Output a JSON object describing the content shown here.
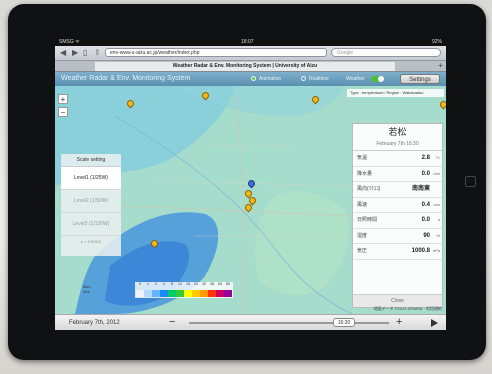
{
  "status": {
    "carrier": "SMSG ᯤ",
    "time": "18:07",
    "battery": "92%"
  },
  "browser": {
    "url": "env-www.u-aizu.ac.jp/weather/index.php",
    "search_placeholder": "Google",
    "tab_title": "Weather Radar & Env. Monitoring System | University of Aizu"
  },
  "app": {
    "title": "Weather Radar & Env. Monitoring System",
    "radio_labels": [
      "Animation",
      "Realtime"
    ],
    "weather_label": "Weather",
    "settings_label": "Settings",
    "type_info": "Type : temperature  ⁄  Region : Wakamatsu"
  },
  "zoom": {
    "in": "+",
    "out": "−"
  },
  "scale_setting": {
    "title": "Scale setting",
    "levels": [
      "Level1 (1/25W)",
      "Level2 (1/50W)",
      "Level3 (1/100W)"
    ],
    "selected_index": 0,
    "note": "x = 1/XXXX"
  },
  "station": {
    "name": "若松",
    "date": "February 7th 16:30",
    "rows": [
      {
        "label": "気温",
        "value": "2.8",
        "unit": "°C"
      },
      {
        "label": "降水量",
        "value": "0.0",
        "unit": "mm"
      },
      {
        "label": "風向(ﾏｸｽｺ)",
        "value": "南南東",
        "unit": ""
      },
      {
        "label": "風速",
        "value": "0.4",
        "unit": "m/s"
      },
      {
        "label": "日照時間",
        "value": "0.0",
        "unit": "h"
      },
      {
        "label": "湿度",
        "value": "90",
        "unit": "%"
      },
      {
        "label": "気圧",
        "value": "1000.8",
        "unit": "hPa"
      }
    ],
    "close_label": "Close"
  },
  "legend": {
    "numbers": [
      "0",
      "1",
      "2",
      "4",
      "8",
      "12",
      "16",
      "24",
      "32",
      "48",
      "64",
      "80"
    ],
    "colors": [
      "#f2f2ff",
      "#b3d9ff",
      "#66b3ff",
      "#1a8cff",
      "#00cc66",
      "#33cc33",
      "#ffff00",
      "#ffcc00",
      "#ff9900",
      "#ff3300",
      "#cc0066",
      "#990099"
    ]
  },
  "scalebar": {
    "km": "5km",
    "mi": "3mi"
  },
  "copyright": "地図データ ©2012 ZENRIN · 利用規約",
  "timebar": {
    "date": "February 7th, 2012",
    "minus": "−",
    "plus": "+",
    "time": "16:30"
  }
}
